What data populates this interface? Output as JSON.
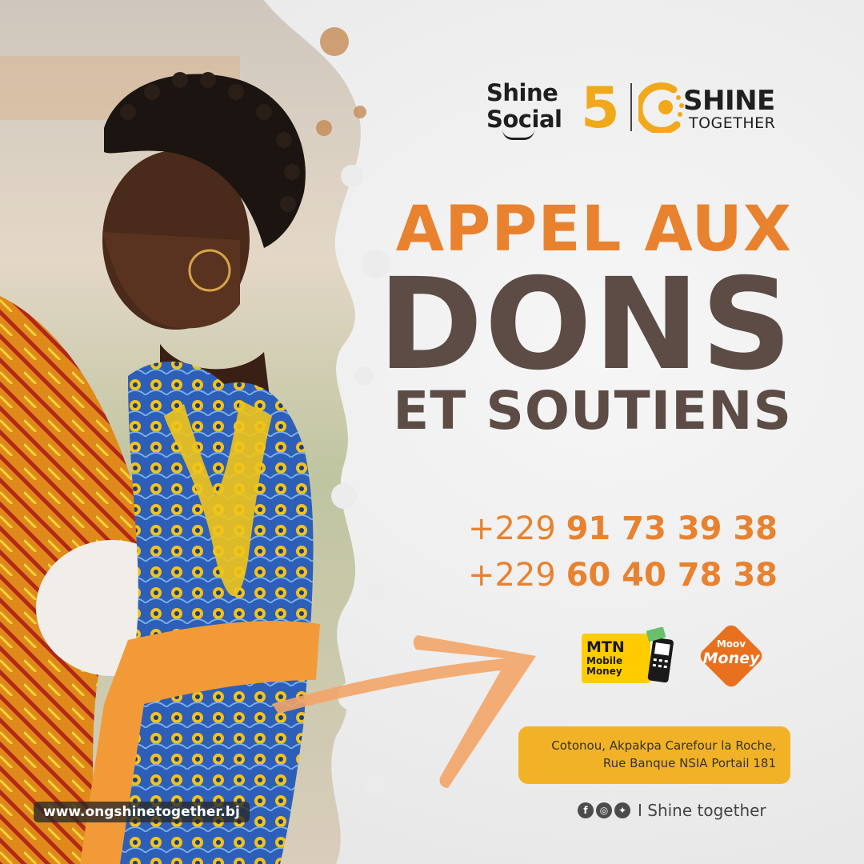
{
  "logos": {
    "shine_social_line1": "Shine",
    "shine_social_line2": "Social",
    "shine_social_number": "5",
    "shine_together_word": "SHINE",
    "shine_together_sub": "TOGETHER"
  },
  "headline": {
    "line1": "APPEL AUX",
    "line2": "DONS",
    "line3": "ET SOUTIENS"
  },
  "phones": [
    {
      "code": "+229",
      "number": "91 73 39 38"
    },
    {
      "code": "+229",
      "number": "60 40 78 38"
    }
  ],
  "payments": {
    "mtn_title": "MTN",
    "mtn_subtitle": "Mobile Money",
    "moov_title": "Moov",
    "moov_subtitle": "Money"
  },
  "address": {
    "line1": "Cotonou, Akpakpa Carefour la Roche,",
    "line2": "Rue Banque NSIA Portail 181"
  },
  "social": {
    "text": "I Shine together",
    "icons": [
      "facebook-icon",
      "instagram-icon",
      "twitter-icon"
    ]
  },
  "website": "www.ongshinetogether.bj",
  "colors": {
    "orange": "#e8822f",
    "brown": "#5c4c45",
    "yellow": "#f2b227",
    "mtn_yellow": "#ffcc00",
    "moov_orange": "#e8701f"
  }
}
